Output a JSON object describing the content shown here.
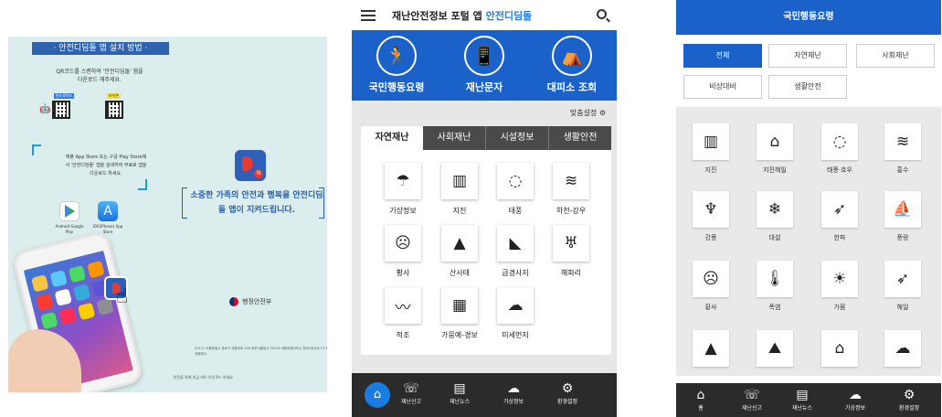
{
  "poster": {
    "title": "· 안전디딤돌 앱 설치 방법 ·",
    "instruction": "QR코드를 스캔하여 '안전디딤돌' 앱을 다운로드 해주세요.",
    "qr_android_label": "안드로이드",
    "qr_ios_label": "아이폰",
    "store_text": "애플 App Store 또는 구글 Play Store에서 '안전디딤돌' 앱을 검색하여 무료로 앱을 다운로드 하세요.",
    "store_android": "Android Google Play",
    "store_ios": "IOS(iPhone) App Store",
    "slogan": "소중한 가족의 안전과 행복을 안전디딤돌 앱이 지켜드립니다.",
    "ministry": "행정안전부",
    "address": "03171 서울특별시 종로구 세종대로 209 정부서울청사 30128 세종특별자치시 정부2청사로 13 정부세종청사",
    "footer": "안전을 위해 지금 바로 다운로드 하세요"
  },
  "app_home": {
    "title_main": "재난안전정보 포털 앱 ",
    "title_accent": "안전디딤돌",
    "hero": [
      {
        "label": "국민행동요령",
        "icon": "running-person-icon",
        "glyph": "🏃"
      },
      {
        "label": "재난문자",
        "icon": "smartphone-icon",
        "glyph": "📱"
      },
      {
        "label": "대피소 조회",
        "icon": "shelter-icon",
        "glyph": "⛺"
      }
    ],
    "custom_setting": "맞춤설정 ⚙",
    "tabs": [
      "자연재난",
      "사회재난",
      "시설정보",
      "생활안전"
    ],
    "grid": [
      {
        "label": "기상정보",
        "icon": "weather-icon",
        "glyph": "☂"
      },
      {
        "label": "지진",
        "icon": "earthquake-icon",
        "glyph": "▥"
      },
      {
        "label": "태풍",
        "icon": "typhoon-icon",
        "glyph": "◌"
      },
      {
        "label": "하천-강우",
        "icon": "river-icon",
        "glyph": "≋"
      },
      {
        "label": "황사",
        "icon": "dust-mask-icon",
        "glyph": "☹"
      },
      {
        "label": "산사태",
        "icon": "landslide-icon",
        "glyph": "▲"
      },
      {
        "label": "급경사지",
        "icon": "steep-slope-icon",
        "glyph": "◣"
      },
      {
        "label": "해파리",
        "icon": "jellyfish-icon",
        "glyph": "♅"
      },
      {
        "label": "적조",
        "icon": "red-tide-icon",
        "glyph": "〰"
      },
      {
        "label": "가뭄예-경보",
        "icon": "drought-icon",
        "glyph": "▦"
      },
      {
        "label": "미세먼지",
        "icon": "fine-dust-icon",
        "glyph": "☁"
      }
    ],
    "nav": [
      {
        "label": "재난신고",
        "icon": "report-icon",
        "glyph": "☏"
      },
      {
        "label": "재난뉴스",
        "icon": "news-icon",
        "glyph": "▤"
      },
      {
        "label": "기상정보",
        "icon": "weather-icon",
        "glyph": "☁"
      },
      {
        "label": "환경설정",
        "icon": "gear-icon",
        "glyph": "⚙"
      }
    ],
    "home_glyph": "⌂"
  },
  "app_guide": {
    "header": "국민행동요령",
    "filters": [
      "전체",
      "자연재난",
      "사회재난",
      "비상대비",
      "생활안전"
    ],
    "grid": [
      {
        "label": "지진",
        "icon": "earthquake-icon",
        "glyph": "▥"
      },
      {
        "label": "지진해일",
        "icon": "tsunami-icon",
        "glyph": "⌂"
      },
      {
        "label": "태풍·호우",
        "icon": "typhoon-icon",
        "glyph": "◌"
      },
      {
        "label": "홍수",
        "icon": "flood-icon",
        "glyph": "≋"
      },
      {
        "label": "강풍",
        "icon": "strong-wind-icon",
        "glyph": "♆"
      },
      {
        "label": "대설",
        "icon": "heavy-snow-icon",
        "glyph": "❄"
      },
      {
        "label": "한파",
        "icon": "cold-wave-icon",
        "glyph": "➶"
      },
      {
        "label": "풍랑",
        "icon": "high-waves-icon",
        "glyph": "⛵"
      },
      {
        "label": "황사",
        "icon": "dust-mask-icon",
        "glyph": "☹"
      },
      {
        "label": "폭염",
        "icon": "thermometer-icon",
        "glyph": "🌡"
      },
      {
        "label": "가뭄",
        "icon": "drought-icon",
        "glyph": "☀"
      },
      {
        "label": "해일",
        "icon": "storm-surge-icon",
        "glyph": "➶"
      },
      {
        "label": "",
        "icon": "landslide-icon",
        "glyph": "▲"
      },
      {
        "label": "",
        "icon": "volcano-icon",
        "glyph": "⛰"
      },
      {
        "label": "",
        "icon": "house-flood-icon",
        "glyph": "⌂"
      },
      {
        "label": "",
        "icon": "cloud-icon",
        "glyph": "☁"
      }
    ],
    "nav": [
      {
        "label": "홈",
        "icon": "home-icon",
        "glyph": "⌂"
      },
      {
        "label": "재난신고",
        "icon": "report-icon",
        "glyph": "☏"
      },
      {
        "label": "재난뉴스",
        "icon": "news-icon",
        "glyph": "▤"
      },
      {
        "label": "기상정보",
        "icon": "weather-icon",
        "glyph": "☁"
      },
      {
        "label": "환경설정",
        "icon": "gear-icon",
        "glyph": "⚙"
      }
    ]
  },
  "colors": {
    "primary_blue": "#1a62c9",
    "poster_bg": "#dbeeed",
    "accent_red": "#e63b2e",
    "nav_bg": "#2b2b2b"
  }
}
